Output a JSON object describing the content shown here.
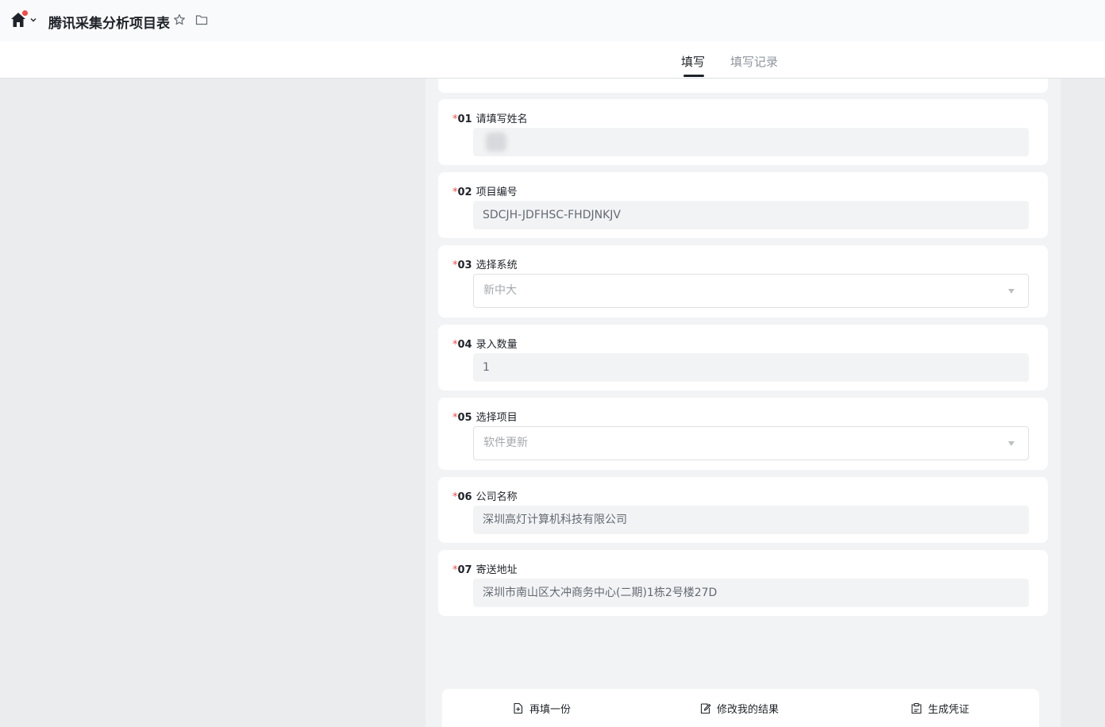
{
  "header": {
    "title": "腾讯采集分析项目表"
  },
  "tabs": [
    {
      "label": "填写",
      "active": true
    },
    {
      "label": "填写记录",
      "active": false
    }
  ],
  "questions": [
    {
      "required": "*",
      "number": "01",
      "label": "请填写姓名",
      "value": "",
      "type": "text"
    },
    {
      "required": "*",
      "number": "02",
      "label": "项目编号",
      "value": "SDCJH-JDFHSC-FHDJNKJV",
      "type": "text"
    },
    {
      "required": "*",
      "number": "03",
      "label": "选择系统",
      "value": "新中大",
      "type": "select"
    },
    {
      "required": "*",
      "number": "04",
      "label": "录入数量",
      "value": "1",
      "type": "text"
    },
    {
      "required": "*",
      "number": "05",
      "label": "选择项目",
      "value": "软件更新",
      "type": "select"
    },
    {
      "required": "*",
      "number": "06",
      "label": "公司名称",
      "value": "深圳高灯计算机科技有限公司",
      "type": "text"
    },
    {
      "required": "*",
      "number": "07",
      "label": "寄送地址",
      "value": " 深圳市南山区大冲商务中心(二期)1栋2号楼27D",
      "type": "text"
    }
  ],
  "actions": {
    "refill": "再填一份",
    "modify": "修改我的结果",
    "voucher": "生成凭证"
  },
  "colors": {
    "required": "#f54a45",
    "text": "#1f2329",
    "muted": "#8f959e",
    "field_bg": "#f2f3f5"
  }
}
